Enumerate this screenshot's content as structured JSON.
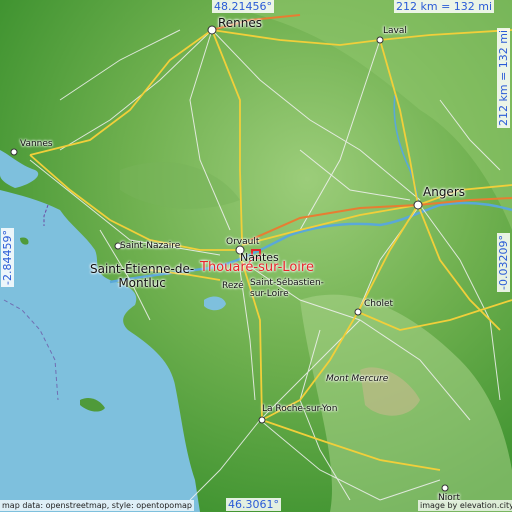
{
  "map": {
    "highlight_place": "Thouaré-sur-Loire",
    "coords": {
      "top": "48.21456°",
      "bottom": "46.3061°",
      "left": "-2.84459°",
      "right": "-0.03209°"
    },
    "scale": {
      "horizontal": "212 km = 132 mi",
      "vertical": "212 km = 132 mi"
    },
    "places": {
      "rennes": "Rennes",
      "laval": "Laval",
      "vannes": "Vannes",
      "angers": "Angers",
      "saint_nazaire": "Saint-Nazaire",
      "orvault": "Orvault",
      "nantes": "Nantes",
      "saint_etienne": "Saint-Étienne-de-\nMontluc",
      "reze": "Rezé",
      "saint_sebastien": "Saint-Sébastien-\nsur-Loire",
      "cholet": "Cholet",
      "mont_mercure": "Mont Mercure",
      "la_roche": "La Roche-sur-Yon",
      "niort": "Niort"
    },
    "credits": {
      "left": "map data: openstreetmap, style: opentopomap",
      "right": "image by elevation.city"
    },
    "colors": {
      "sea": "#7ec0dd",
      "lowland": "#3f9330",
      "upland": "#9cc97a",
      "highlight": "#e8242a",
      "coord_text": "#2a5bd7"
    }
  }
}
